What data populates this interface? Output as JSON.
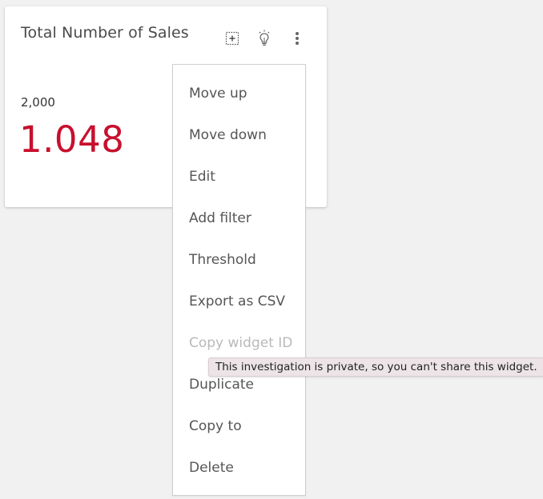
{
  "widget": {
    "title": "Total Number of Sales",
    "threshold_value": "2,000",
    "main_value": "1.048",
    "value_color": "#c8102e",
    "icons": {
      "expand": "expand-icon",
      "insights": "lightbulb-icon",
      "more": "more-vertical-icon"
    }
  },
  "menu": {
    "items": [
      {
        "label": "Move up",
        "disabled": false
      },
      {
        "label": "Move down",
        "disabled": false
      },
      {
        "label": "Edit",
        "disabled": false
      },
      {
        "label": "Add filter",
        "disabled": false
      },
      {
        "label": "Threshold",
        "disabled": false
      },
      {
        "label": "Export as CSV",
        "disabled": false
      },
      {
        "label": "Copy widget ID",
        "disabled": true
      },
      {
        "label": "Duplicate",
        "disabled": false
      },
      {
        "label": "Copy to",
        "disabled": false
      },
      {
        "label": "Delete",
        "disabled": false
      }
    ]
  },
  "tooltip": {
    "text": "This investigation is private, so you can't share this widget."
  }
}
